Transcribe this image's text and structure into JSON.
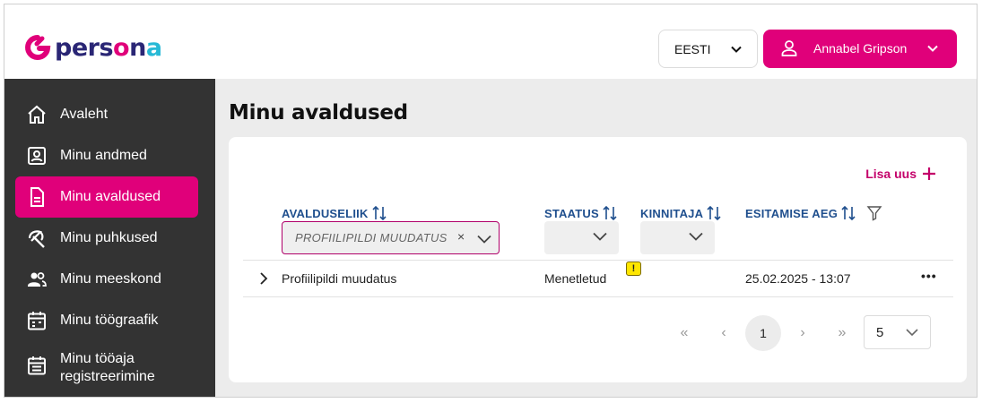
{
  "brand": {
    "logo_parts": [
      "pers",
      "o",
      "n",
      "a"
    ],
    "colors": {
      "primary": "#e0007a",
      "dark": "#2a2675",
      "cyan": "#27b9d6",
      "sidebar": "#333333",
      "link": "#1f4f8e"
    }
  },
  "header": {
    "language": "EESTI",
    "user_name": "Annabel Gripson"
  },
  "sidebar": {
    "items": [
      {
        "label": "Avaleht",
        "icon": "home-icon"
      },
      {
        "label": "Minu andmed",
        "icon": "id-card-icon"
      },
      {
        "label": "Minu avaldused",
        "icon": "document-icon",
        "active": true
      },
      {
        "label": "Minu puhkused",
        "icon": "beach-umbrella-icon"
      },
      {
        "label": "Minu meeskond",
        "icon": "team-icon"
      },
      {
        "label": "Minu töögraafik",
        "icon": "calendar-icon"
      },
      {
        "label_line1": "Minu tööaja",
        "label_line2": "registreerimine",
        "icon": "time-register-icon"
      }
    ]
  },
  "main": {
    "title": "Minu avaldused",
    "add_new": "Lisa uus",
    "columns": {
      "type": "AVALDUSELIIK",
      "status": "STAATUS",
      "approver": "KINNITAJA",
      "submitted": "ESITAMISE AEG"
    },
    "filters": {
      "type_value": "PROFIILIPILDI MUUDATUS",
      "clear": "×"
    },
    "rows": [
      {
        "type": "Profiilipildi muudatus",
        "status": "Menetletud",
        "warning": "!",
        "approver": "",
        "submitted": "25.02.2025 - 13:07",
        "actions": "•••"
      }
    ],
    "pagination": {
      "first": "«",
      "prev": "‹",
      "current_page": "1",
      "next": "›",
      "last": "»",
      "page_size": "5"
    }
  }
}
